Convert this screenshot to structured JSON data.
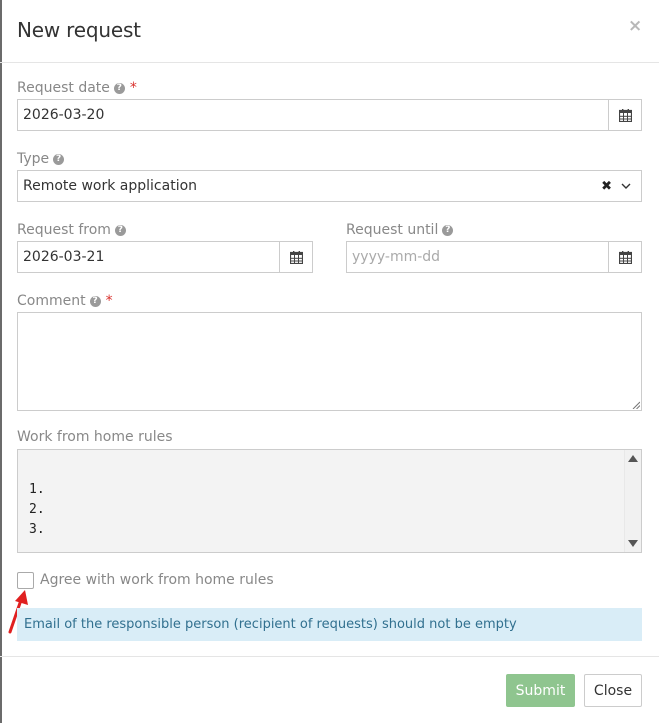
{
  "modal": {
    "title": "New request",
    "close_glyph": "×"
  },
  "form": {
    "request_date": {
      "label": "Request date",
      "required_mark": "*",
      "value": "2026-03-20",
      "icon": "calendar-icon"
    },
    "type": {
      "label": "Type",
      "value": "Remote work application",
      "clear_icon": "clear-x-icon",
      "dropdown_icon": "chevron-down-icon"
    },
    "request_from": {
      "label": "Request from",
      "value": "2026-03-21",
      "icon": "calendar-icon"
    },
    "request_until": {
      "label": "Request until",
      "value": "",
      "placeholder": "yyyy-mm-dd",
      "icon": "calendar-icon"
    },
    "comment": {
      "label": "Comment",
      "required_mark": "*",
      "value": ""
    },
    "rules": {
      "label": "Work from home rules",
      "lines": [
        "1.",
        "2.",
        "3."
      ]
    },
    "agree": {
      "label": "Agree with work from home rules",
      "checked": false
    },
    "alert": {
      "text": "Email of the responsible person (recipient of requests) should not be empty"
    }
  },
  "footer": {
    "submit_label": "Submit",
    "close_label": "Close"
  },
  "colors": {
    "required": "#d9302c",
    "submit_bg": "#8fc58f",
    "alert_bg": "#d9edf7",
    "alert_text": "#31708f",
    "annotation_arrow": "#e02020"
  }
}
